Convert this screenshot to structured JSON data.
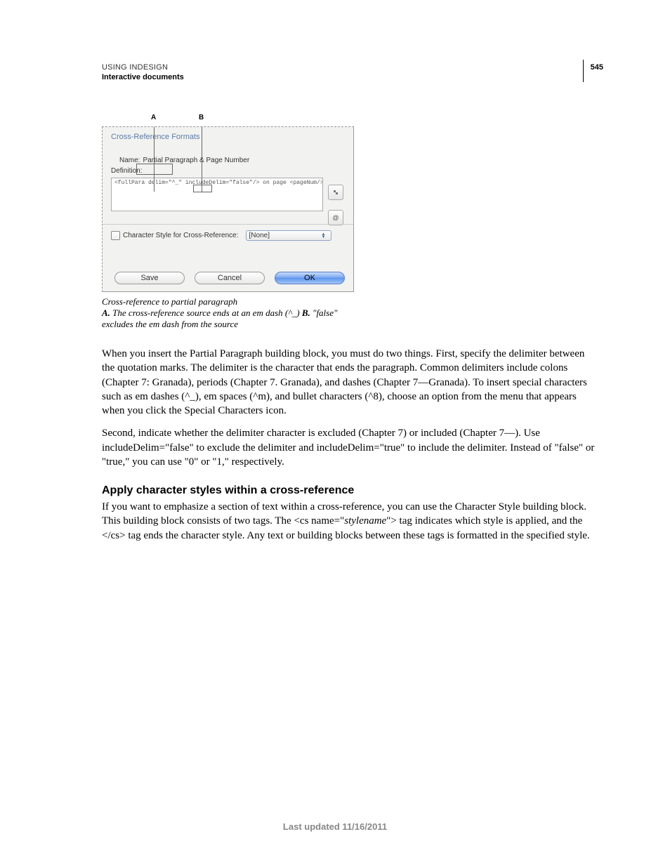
{
  "header": {
    "title": "USING INDESIGN",
    "section": "Interactive documents",
    "page_number": "545"
  },
  "dialog": {
    "panel_title": "Cross-Reference Formats",
    "callouts": {
      "a": "A",
      "b": "B"
    },
    "name_label": "Name:",
    "name_value": "Partial Paragraph & Page Number",
    "definition_label": "Definition:",
    "definition_code": "<fullPara delim=\"^_\" includeDelim=\"false\"/> on page <pageNum/>",
    "char_style_label": "Character Style for Cross-Reference:",
    "char_style_value": "[None]",
    "buttons": {
      "save": "Save",
      "cancel": "Cancel",
      "ok": "OK"
    }
  },
  "caption": {
    "line1": "Cross-reference to partial paragraph",
    "a_label": "A.",
    "a_text": " The cross-reference source ends at an em dash (^_)  ",
    "b_label": "B.",
    "b_text": " \"false\" excludes the em dash from the source"
  },
  "paragraphs": {
    "p1": "When you insert the Partial Paragraph building block, you must do two things. First, specify the delimiter between the quotation marks. The delimiter is the character that ends the paragraph. Common delimiters include colons (Chapter 7: Granada), periods (Chapter 7. Granada), and dashes (Chapter 7—Granada). To insert special characters such as em dashes (^_), em spaces (^m), and bullet characters (^8), choose an option from the menu that appears when you click the Special Characters icon.",
    "p2": "Second, indicate whether the delimiter character is excluded (Chapter 7) or included (Chapter 7—). Use includeDelim=\"false\" to exclude the delimiter and includeDelim=\"true\" to include the delimiter. Instead of \"false\" or \"true,\" you can use \"0\" or \"1,\" respectively."
  },
  "section2": {
    "heading": "Apply character styles within a cross-reference",
    "p_pre": "If you want to emphasize a section of text within a cross-reference, you can use the Character Style building block. This building block consists of two tags. The <cs name=\"",
    "stylename": "stylename",
    "p_post": "\"> tag indicates which style is applied, and the </cs> tag ends the character style. Any text or building blocks between these tags is formatted in the specified style."
  },
  "footer": {
    "text": "Last updated 11/16/2011"
  }
}
